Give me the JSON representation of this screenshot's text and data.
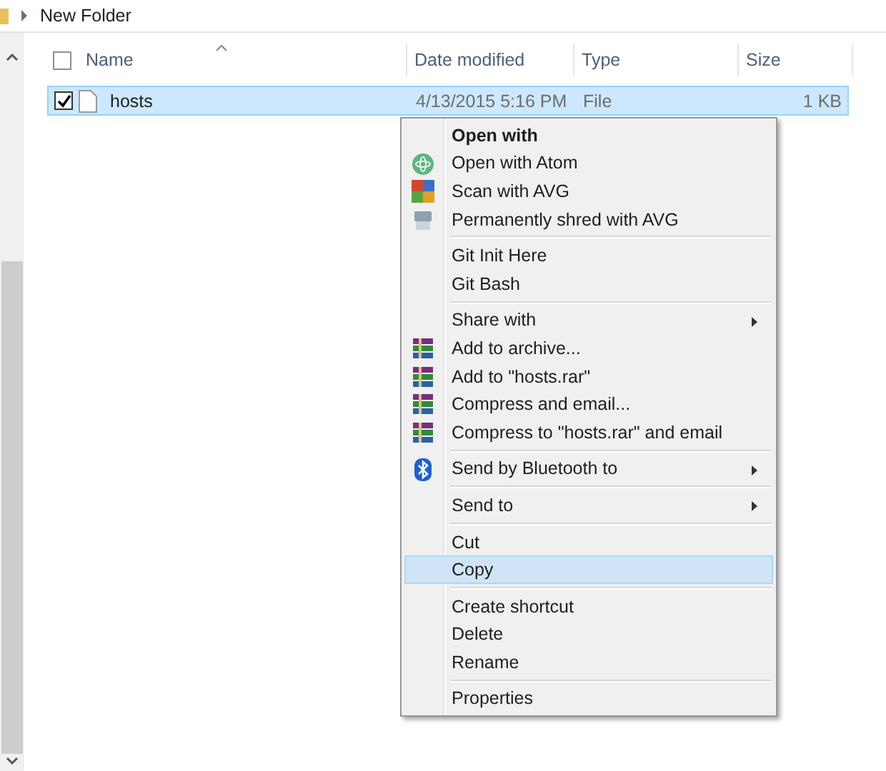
{
  "breadcrumb": {
    "items": [
      "New Folder"
    ]
  },
  "table": {
    "header_checkbox": {
      "checked": false
    },
    "columns": [
      {
        "label": "Name",
        "sorted": true
      },
      {
        "label": "Date modified",
        "sorted": false
      },
      {
        "label": "Type",
        "sorted": false
      },
      {
        "label": "Size",
        "sorted": false
      }
    ],
    "rows": [
      {
        "name": "hosts",
        "date": "4/13/2015 5:16 PM",
        "type": "File",
        "size": "1 KB",
        "selected": true,
        "checked": true
      }
    ]
  },
  "context_menu": {
    "sections": [
      [
        {
          "label": "Open with",
          "kind": "plain",
          "default": true,
          "submenu": false,
          "selected": false
        },
        {
          "label": "Open with Atom",
          "kind": "atom",
          "default": false,
          "submenu": false,
          "selected": false
        },
        {
          "label": "Scan with AVG",
          "kind": "avg",
          "default": false,
          "submenu": false,
          "selected": false
        },
        {
          "label": "Permanently shred with AVG",
          "kind": "shred",
          "default": false,
          "submenu": false,
          "selected": false
        }
      ],
      [
        {
          "label": "Git Init Here",
          "kind": "plain",
          "default": false,
          "submenu": false,
          "selected": false
        },
        {
          "label": "Git Bash",
          "kind": "plain",
          "default": false,
          "submenu": false,
          "selected": false
        }
      ],
      [
        {
          "label": "Share with",
          "kind": "plain",
          "default": false,
          "submenu": true,
          "selected": false
        },
        {
          "label": "Add to archive...",
          "kind": "archive",
          "default": false,
          "submenu": false,
          "selected": false
        },
        {
          "label": "Add to \"hosts.rar\"",
          "kind": "archive",
          "default": false,
          "submenu": false,
          "selected": false
        },
        {
          "label": "Compress and email...",
          "kind": "archive",
          "default": false,
          "submenu": false,
          "selected": false
        },
        {
          "label": "Compress to \"hosts.rar\" and email",
          "kind": "archive",
          "default": false,
          "submenu": false,
          "selected": false
        }
      ],
      [
        {
          "label": "Send by Bluetooth to",
          "kind": "bluetooth",
          "default": false,
          "submenu": true,
          "selected": false
        }
      ],
      [
        {
          "label": "Send to",
          "kind": "plain",
          "default": false,
          "submenu": true,
          "selected": false
        }
      ],
      [
        {
          "label": "Cut",
          "kind": "plain",
          "default": false,
          "submenu": false,
          "selected": false
        },
        {
          "label": "Copy",
          "kind": "plain",
          "default": false,
          "submenu": false,
          "selected": true
        }
      ],
      [
        {
          "label": "Create shortcut",
          "kind": "plain",
          "default": false,
          "submenu": false,
          "selected": false
        },
        {
          "label": "Delete",
          "kind": "plain",
          "default": false,
          "submenu": false,
          "selected": false
        },
        {
          "label": "Rename",
          "kind": "plain",
          "default": false,
          "submenu": false,
          "selected": false
        }
      ],
      [
        {
          "label": "Properties",
          "kind": "plain",
          "default": false,
          "submenu": false,
          "selected": false
        }
      ]
    ]
  }
}
